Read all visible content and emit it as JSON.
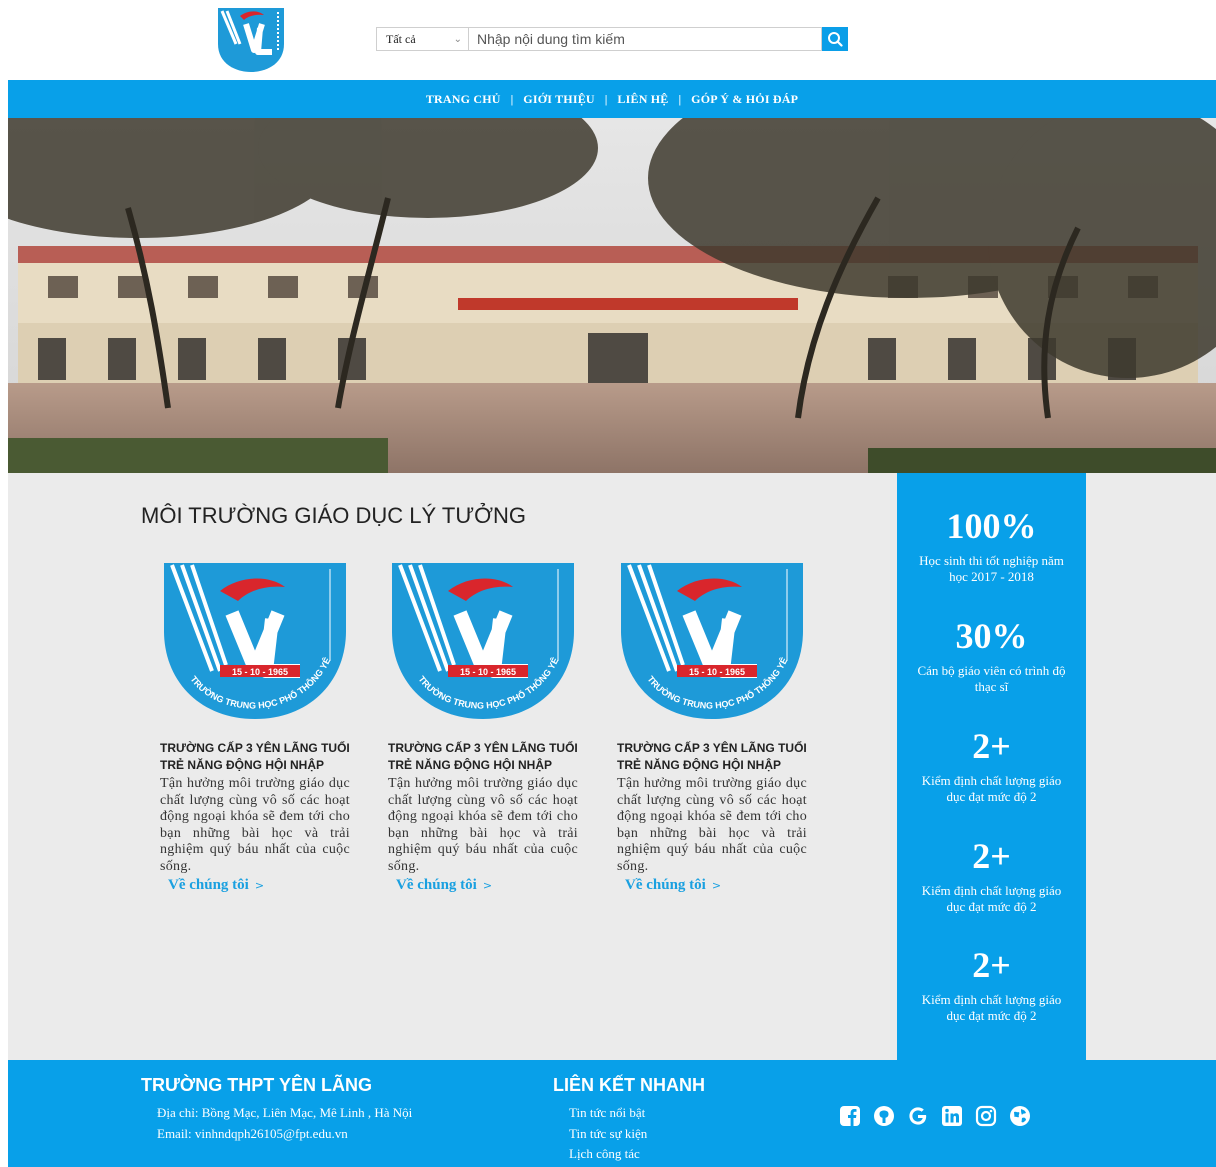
{
  "header": {
    "search": {
      "category": "Tất cả",
      "placeholder": "Nhập nội dung tìm kiếm"
    }
  },
  "nav": {
    "items": [
      "TRANG CHỦ",
      "GIỚI THIỆU",
      "LIÊN HỆ",
      "GÓP Ý & HỎI ĐÁP"
    ],
    "separator": "|"
  },
  "main": {
    "title": "MÔI TRƯỜNG GIÁO DỤC LÝ TƯỞNG",
    "emblem": {
      "date": "15 - 10 - 1965",
      "arc_text": "TRƯỜNG TRUNG HỌC PHỔ THÔNG YÊN LÃNG"
    },
    "cards": [
      {
        "title": "TRƯỜNG CẤP 3 YÊN LÃNG TUỔI TRẺ NĂNG ĐỘNG HỘI NHẬP",
        "text": "Tận hưởng môi trường giáo dục chất lượng cùng vô số các hoạt động ngoại khóa sẽ đem tới cho bạn những bài học và trải nghiệm quý báu nhất của cuộc sống.",
        "link": "Về chúng tôi",
        "link_arrow": ">"
      },
      {
        "title": "TRƯỜNG CẤP 3 YÊN LÃNG TUỔI TRẺ NĂNG ĐỘNG HỘI NHẬP",
        "text": "Tận hưởng môi trường giáo dục chất lượng cùng vô số các hoạt động ngoại khóa sẽ đem tới cho bạn những bài học và trải nghiệm quý báu nhất của cuộc sống.",
        "link": "Về chúng tôi",
        "link_arrow": ">"
      },
      {
        "title": "TRƯỜNG CẤP 3 YÊN LÃNG TUỔI TRẺ NĂNG ĐỘNG HỘI NHẬP",
        "text": "Tận hưởng môi trường giáo dục chất lượng cùng vô số các hoạt động ngoại khóa sẽ đem tới cho bạn những bài học và trải nghiệm quý báu nhất của cuộc sống.",
        "link": "Về chúng tôi",
        "link_arrow": ">"
      }
    ],
    "stats": [
      {
        "value": "100%",
        "label": "Học sinh thi tốt nghiệp năm học 2017 - 2018"
      },
      {
        "value": "30%",
        "label": "Cán bộ giáo viên có trình độ thạc sĩ"
      },
      {
        "value": "2+",
        "label": "Kiểm định chất lượng giáo dục đạt mức độ 2"
      },
      {
        "value": "2+",
        "label": "Kiểm định chất lượng giáo dục đạt mức độ 2"
      },
      {
        "value": "2+",
        "label": "Kiểm định chất lượng giáo dục đạt mức độ 2"
      }
    ]
  },
  "footer": {
    "school_title": "TRƯỜNG THPT YÊN LÃNG",
    "address": "Địa chỉ: Bồng Mạc, Liên Mạc, Mê Linh , Hà Nội",
    "email": "Email: vinhndqph26105@fpt.edu.vn",
    "links_title": "LIÊN KẾT NHANH",
    "links": [
      "Tin tức nổi bật",
      "Tin tức sự kiện",
      "Lịch công tác"
    ],
    "social": [
      "facebook-icon",
      "github-icon",
      "google-icon",
      "linkedin-icon",
      "instagram-icon",
      "globe-icon"
    ]
  },
  "colors": {
    "brand_blue": "#08a0e9",
    "link_blue": "#1aa0e0",
    "content_bg": "#ebebeb",
    "emblem_red": "#d9262c"
  }
}
